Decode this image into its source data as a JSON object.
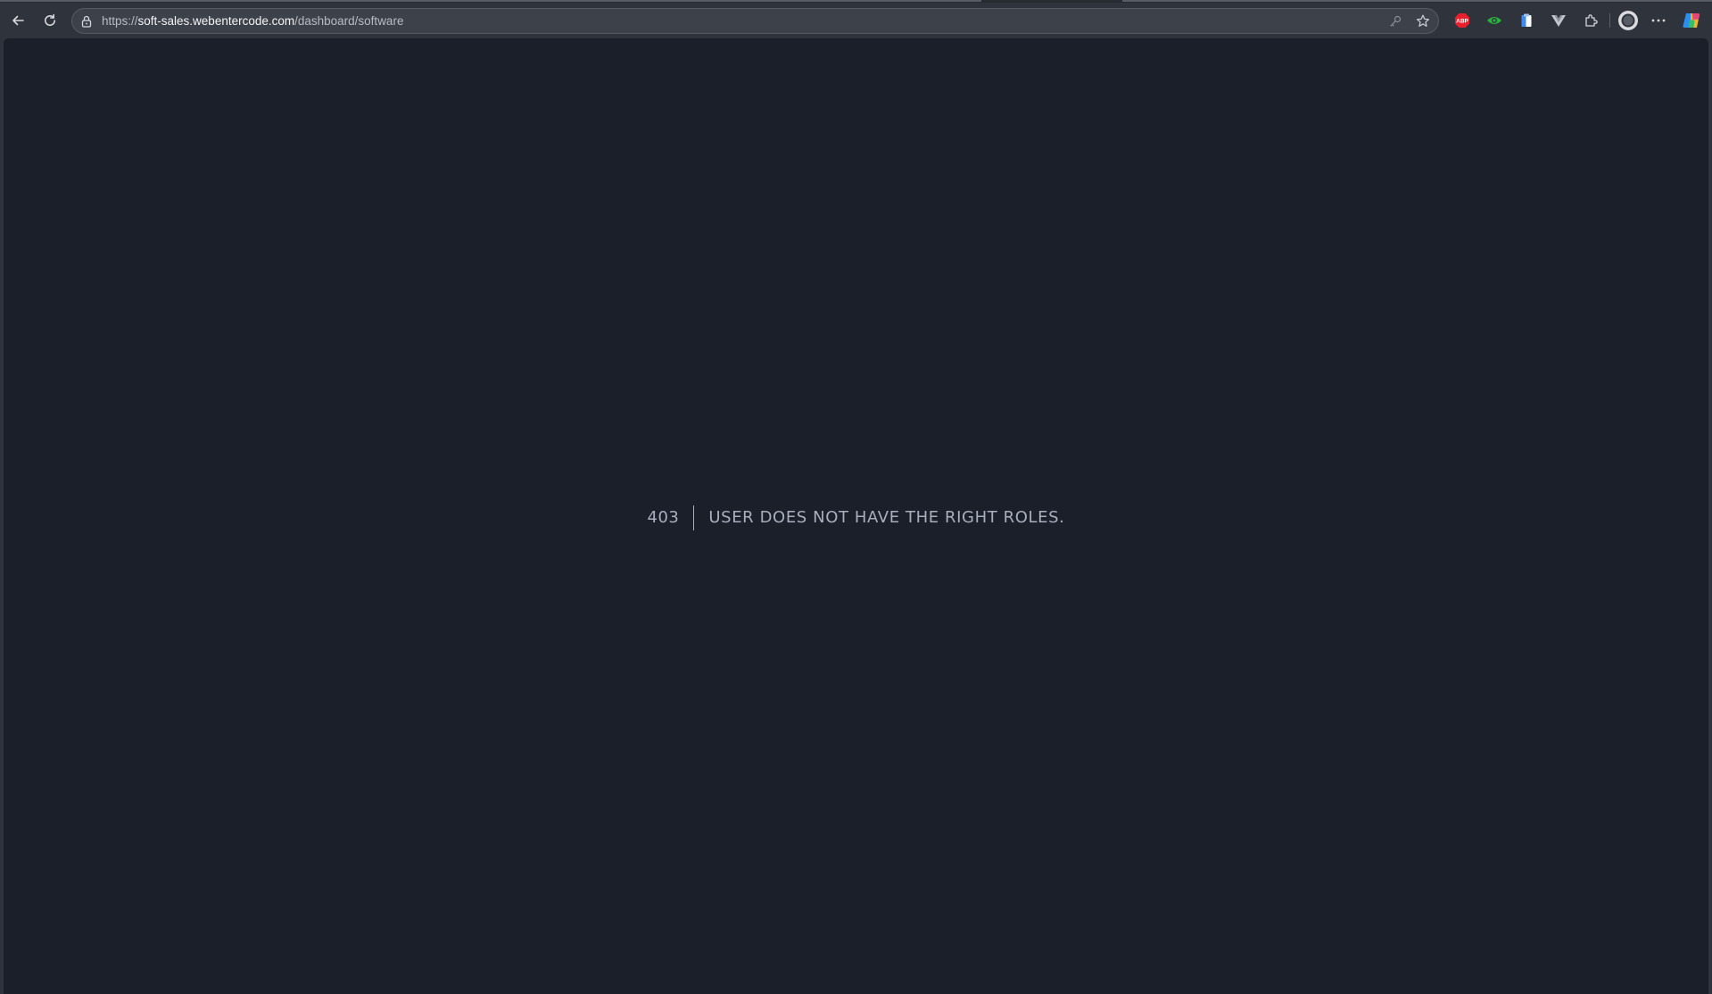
{
  "browser": {
    "address_bar": {
      "url_scheme": "https://",
      "url_host": "soft-sales.webentercode.com",
      "url_path": "/dashboard/software"
    },
    "extensions": [
      {
        "name": "adblock-plus-icon",
        "label": "ABP"
      },
      {
        "name": "green-extension-icon"
      },
      {
        "name": "clipboard-extension-icon"
      },
      {
        "name": "vue-devtools-icon"
      },
      {
        "name": "extensions-puzzle-icon"
      }
    ]
  },
  "page": {
    "error_code": "403",
    "error_message": "USER DOES NOT HAVE THE RIGHT ROLES."
  },
  "colors": {
    "page_background": "#1b1f2a",
    "error_text": "#a8aebb",
    "browser_chrome": "#2f333b"
  }
}
